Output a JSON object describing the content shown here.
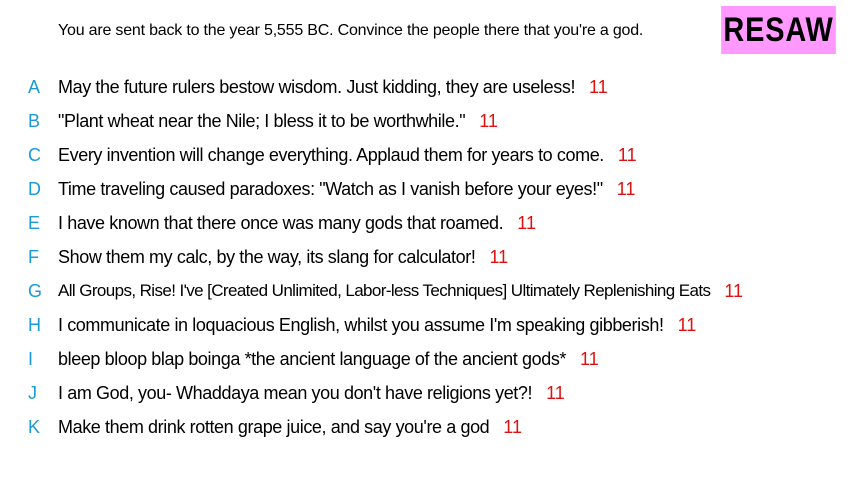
{
  "prompt": "You are sent back to the year 5,555 BC. Convince the people there that you're a god.",
  "badge": {
    "label": "RESAW",
    "color": "#ff99ff"
  },
  "colors": {
    "letter": "#1a9ad6",
    "score": "#e01010"
  },
  "answers": [
    {
      "letter": "A",
      "text": "May the future rulers bestow wisdom. Just kidding, they are useless!",
      "score": "11"
    },
    {
      "letter": "B",
      "text": "\"Plant wheat near the Nile; I bless it to be worthwhile.\"",
      "score": "11"
    },
    {
      "letter": "C",
      "text": "Every invention will change everything. Applaud them for years to come.",
      "score": "11"
    },
    {
      "letter": "D",
      "text": "Time traveling caused paradoxes: \"Watch as I vanish before your eyes!\"",
      "score": "11"
    },
    {
      "letter": "E",
      "text": "I have known that there once was many gods that roamed.",
      "score": "11"
    },
    {
      "letter": "F",
      "text": "Show them my calc, by the way, its slang for calculator!",
      "score": "11"
    },
    {
      "letter": "G",
      "text": "All Groups, Rise! I've [Created Unlimited, Labor-less Techniques] Ultimately Replenishing Eats",
      "score": "11"
    },
    {
      "letter": "H",
      "text": "I communicate in loquacious English, whilst you assume I'm speaking gibberish!",
      "score": "11"
    },
    {
      "letter": "I",
      "text": "bleep bloop blap boinga *the ancient language of the ancient gods*",
      "score": "11"
    },
    {
      "letter": "J",
      "text": "I am God, you- Whaddaya mean you don't have religions yet?!",
      "score": "11"
    },
    {
      "letter": "K",
      "text": "Make them drink rotten grape juice, and say you're a god",
      "score": "11"
    }
  ]
}
